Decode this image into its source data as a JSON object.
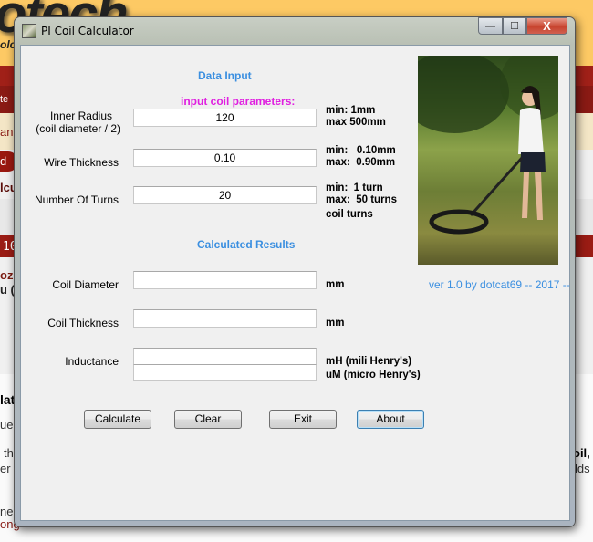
{
  "background": {
    "logo": "otech",
    "logo_sub": "olc",
    "fragments": [
      "te",
      "anc",
      "d",
      "lcu",
      "10",
      "ozh",
      "u (",
      "lat",
      "ue",
      "th",
      "er",
      "ned",
      "ong",
      "oil,",
      "lds"
    ]
  },
  "window": {
    "title": "PI Coil Calculator",
    "minimize": "—",
    "maximize": "☐",
    "close": "X"
  },
  "input": {
    "heading": "Data Input",
    "subheading": "input coil parameters:",
    "inner_radius": {
      "label1": "Inner Radius",
      "label2": "(coil diameter / 2)",
      "value": "120",
      "note1": "min:  1mm",
      "note2": "max 500mm"
    },
    "wire_thickness": {
      "label": "Wire Thickness",
      "value": "0.10",
      "note1": "min:   0.10mm",
      "note2": "max:  0.90mm"
    },
    "turns": {
      "label": "Number Of Turns",
      "value": "20",
      "note1": "min:  1 turn",
      "note2": "max:  50 turns",
      "note3": "coil turns"
    }
  },
  "results": {
    "heading": "Calculated Results",
    "coil_diameter": {
      "label": "Coil Diameter",
      "value": "",
      "unit": "mm"
    },
    "coil_thickness": {
      "label": "Coil Thickness",
      "value": "",
      "unit": "mm"
    },
    "inductance": {
      "label": "Inductance",
      "value_mh": "",
      "value_uh": "",
      "unit_mh": "mH (mili Henry's)",
      "unit_uh": "uM (micro Henry's)"
    }
  },
  "version": "ver 1.0 by dotcat69 -- 2017 --",
  "buttons": {
    "calculate": "Calculate",
    "clear": "Clear",
    "exit": "Exit",
    "about": "About"
  }
}
